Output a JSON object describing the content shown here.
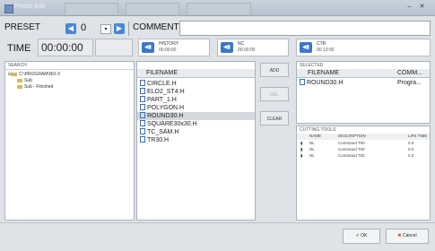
{
  "window": {
    "title": "Preset Edit"
  },
  "toolbar": {
    "preset_label": "PRESET",
    "preset_value": "0",
    "comment_label": "COMMENT",
    "time_label": "TIME",
    "time_value": "00:00:00"
  },
  "status_panels": [
    {
      "name": "HISTORY",
      "value": "00:00:00"
    },
    {
      "name": "NC",
      "value": "00:00:00"
    },
    {
      "name": "CTR",
      "value": "00 13:00"
    }
  ],
  "search": {
    "label": "SEARCH",
    "tree": [
      "C:\\PROGRAM\\NO-3",
      "Sub",
      "Sub - Finished"
    ]
  },
  "files": {
    "header": "FILENAME",
    "items": [
      "CIRCLE.H",
      "ELO2_ST4.H",
      "PART_1.H",
      "POLYGON.H",
      "ROUND30.H",
      "SQUARE30x30.H",
      "TC_SAM.H",
      "TR30.H"
    ],
    "selected_index": 4
  },
  "middle_buttons": {
    "add": "ADD",
    "remove": "DEL",
    "clear": "CLEAR"
  },
  "selected": {
    "label": "SELECTED",
    "col_filename": "FILENAME",
    "col_comment": "COMM...",
    "rows": [
      {
        "filename": "ROUND30.H",
        "comment": "Progra..."
      }
    ]
  },
  "cutting_tools": {
    "label": "CUTTING TOOLS",
    "columns": [
      "NAME",
      "DESCRIPTION",
      "LIFE TIME"
    ],
    "rows": [
      {
        "name": "NL",
        "description": "Command T00",
        "life": "0.0"
      },
      {
        "name": "NL",
        "description": "Command T00",
        "life": "0.0"
      },
      {
        "name": "NL",
        "description": "Command T00",
        "life": "0.0"
      }
    ]
  },
  "footer": {
    "ok": "OK",
    "cancel": "Cancel"
  }
}
